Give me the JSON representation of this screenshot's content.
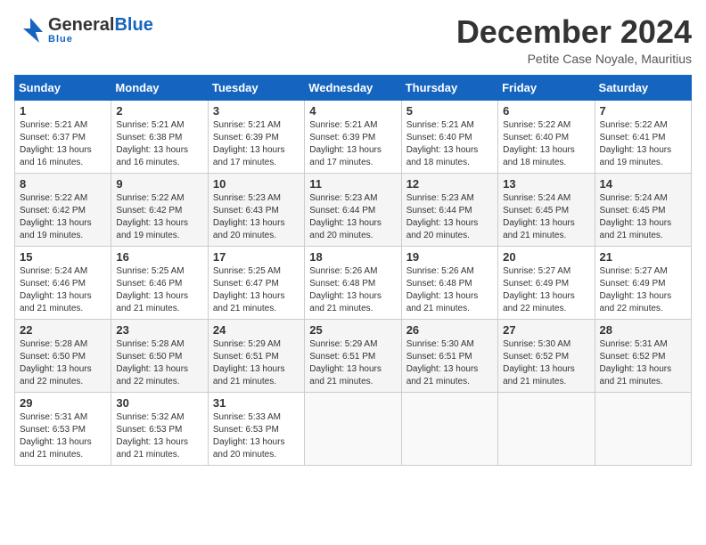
{
  "header": {
    "logo_general": "General",
    "logo_blue": "Blue",
    "month_title": "December 2024",
    "subtitle": "Petite Case Noyale, Mauritius"
  },
  "days_of_week": [
    "Sunday",
    "Monday",
    "Tuesday",
    "Wednesday",
    "Thursday",
    "Friday",
    "Saturday"
  ],
  "weeks": [
    [
      {
        "day": 1,
        "sunrise": "5:21 AM",
        "sunset": "6:37 PM",
        "daylight": "13 hours and 16 minutes."
      },
      {
        "day": 2,
        "sunrise": "5:21 AM",
        "sunset": "6:38 PM",
        "daylight": "13 hours and 16 minutes."
      },
      {
        "day": 3,
        "sunrise": "5:21 AM",
        "sunset": "6:39 PM",
        "daylight": "13 hours and 17 minutes."
      },
      {
        "day": 4,
        "sunrise": "5:21 AM",
        "sunset": "6:39 PM",
        "daylight": "13 hours and 17 minutes."
      },
      {
        "day": 5,
        "sunrise": "5:21 AM",
        "sunset": "6:40 PM",
        "daylight": "13 hours and 18 minutes."
      },
      {
        "day": 6,
        "sunrise": "5:22 AM",
        "sunset": "6:40 PM",
        "daylight": "13 hours and 18 minutes."
      },
      {
        "day": 7,
        "sunrise": "5:22 AM",
        "sunset": "6:41 PM",
        "daylight": "13 hours and 19 minutes."
      }
    ],
    [
      {
        "day": 8,
        "sunrise": "5:22 AM",
        "sunset": "6:42 PM",
        "daylight": "13 hours and 19 minutes."
      },
      {
        "day": 9,
        "sunrise": "5:22 AM",
        "sunset": "6:42 PM",
        "daylight": "13 hours and 19 minutes."
      },
      {
        "day": 10,
        "sunrise": "5:23 AM",
        "sunset": "6:43 PM",
        "daylight": "13 hours and 20 minutes."
      },
      {
        "day": 11,
        "sunrise": "5:23 AM",
        "sunset": "6:44 PM",
        "daylight": "13 hours and 20 minutes."
      },
      {
        "day": 12,
        "sunrise": "5:23 AM",
        "sunset": "6:44 PM",
        "daylight": "13 hours and 20 minutes."
      },
      {
        "day": 13,
        "sunrise": "5:24 AM",
        "sunset": "6:45 PM",
        "daylight": "13 hours and 21 minutes."
      },
      {
        "day": 14,
        "sunrise": "5:24 AM",
        "sunset": "6:45 PM",
        "daylight": "13 hours and 21 minutes."
      }
    ],
    [
      {
        "day": 15,
        "sunrise": "5:24 AM",
        "sunset": "6:46 PM",
        "daylight": "13 hours and 21 minutes."
      },
      {
        "day": 16,
        "sunrise": "5:25 AM",
        "sunset": "6:46 PM",
        "daylight": "13 hours and 21 minutes."
      },
      {
        "day": 17,
        "sunrise": "5:25 AM",
        "sunset": "6:47 PM",
        "daylight": "13 hours and 21 minutes."
      },
      {
        "day": 18,
        "sunrise": "5:26 AM",
        "sunset": "6:48 PM",
        "daylight": "13 hours and 21 minutes."
      },
      {
        "day": 19,
        "sunrise": "5:26 AM",
        "sunset": "6:48 PM",
        "daylight": "13 hours and 21 minutes."
      },
      {
        "day": 20,
        "sunrise": "5:27 AM",
        "sunset": "6:49 PM",
        "daylight": "13 hours and 22 minutes."
      },
      {
        "day": 21,
        "sunrise": "5:27 AM",
        "sunset": "6:49 PM",
        "daylight": "13 hours and 22 minutes."
      }
    ],
    [
      {
        "day": 22,
        "sunrise": "5:28 AM",
        "sunset": "6:50 PM",
        "daylight": "13 hours and 22 minutes."
      },
      {
        "day": 23,
        "sunrise": "5:28 AM",
        "sunset": "6:50 PM",
        "daylight": "13 hours and 22 minutes."
      },
      {
        "day": 24,
        "sunrise": "5:29 AM",
        "sunset": "6:51 PM",
        "daylight": "13 hours and 21 minutes."
      },
      {
        "day": 25,
        "sunrise": "5:29 AM",
        "sunset": "6:51 PM",
        "daylight": "13 hours and 21 minutes."
      },
      {
        "day": 26,
        "sunrise": "5:30 AM",
        "sunset": "6:51 PM",
        "daylight": "13 hours and 21 minutes."
      },
      {
        "day": 27,
        "sunrise": "5:30 AM",
        "sunset": "6:52 PM",
        "daylight": "13 hours and 21 minutes."
      },
      {
        "day": 28,
        "sunrise": "5:31 AM",
        "sunset": "6:52 PM",
        "daylight": "13 hours and 21 minutes."
      }
    ],
    [
      {
        "day": 29,
        "sunrise": "5:31 AM",
        "sunset": "6:53 PM",
        "daylight": "13 hours and 21 minutes."
      },
      {
        "day": 30,
        "sunrise": "5:32 AM",
        "sunset": "6:53 PM",
        "daylight": "13 hours and 21 minutes."
      },
      {
        "day": 31,
        "sunrise": "5:33 AM",
        "sunset": "6:53 PM",
        "daylight": "13 hours and 20 minutes."
      },
      null,
      null,
      null,
      null
    ]
  ]
}
